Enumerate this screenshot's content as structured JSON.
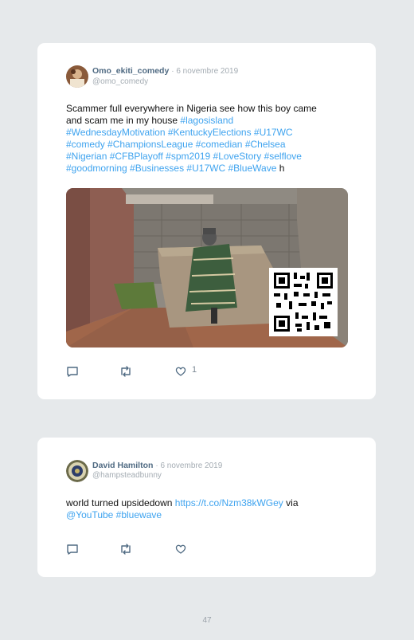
{
  "tweets": [
    {
      "name": "Omo_ekiti_comedy",
      "date": "· 6 novembre 2019",
      "handle": "@omo_comedy",
      "text_line1": "Scammer full everywhere in Nigeria see how this boy came",
      "text_line2_prefix": "and scam me in my house ",
      "text_line2_tag": "#lagosisland",
      "text_line3": "#WednesdayMotivation #KentuckyElections #U17WC",
      "text_line4": "#comedy #ChampionsLeague #comedian #Chelsea",
      "text_line5": "#Nigerian #CFBPlayoff #spm2019 #LoveStory #selflove",
      "text_line6_tags": "#goodmorning #Businesses #U17WC #BlueWave",
      "text_line6_suffix": " h",
      "like_count": "1",
      "icons": [
        "reply-icon",
        "retweet-icon",
        "like-icon"
      ]
    },
    {
      "name": "David Hamilton",
      "date": "· 6 novembre 2019",
      "handle": "@hampsteadbunny",
      "text_line1_prefix": "world turned upsidedown ",
      "text_line1_link": "https://t.co/Nzm38kWGey",
      "text_line1_suffix": " via",
      "text_line2": "@YouTube #bluewave",
      "icons": [
        "reply-icon",
        "retweet-icon",
        "like-icon"
      ]
    }
  ],
  "page_number": "47",
  "colors": {
    "background": "#e6e9eb",
    "card": "#ffffff",
    "link": "#3ea3ef",
    "name": "#4f6a82",
    "muted": "#a4acb3",
    "icon": "#4f6a82"
  }
}
